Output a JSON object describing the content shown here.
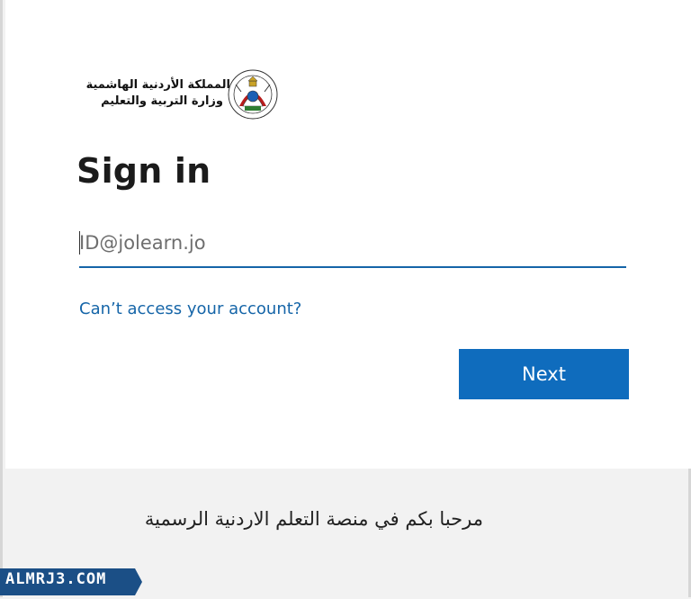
{
  "logo": {
    "line1": "المملكة الأردنية الهاشمية",
    "line2": "وزارة التربية والتعليم"
  },
  "signin": {
    "title": "Sign in",
    "email_placeholder": "ID@jolearn.jo",
    "email_value": "",
    "help_link": "Can’t access your account?",
    "next_label": "Next"
  },
  "footer": {
    "welcome": "مرحبا بكم في منصة التعلم الاردنية الرسمية"
  },
  "watermark": {
    "text": "ALMRJ3.COM"
  },
  "colors": {
    "accent": "#0f6cbd",
    "link": "#1565a8",
    "footer_bg": "#f2f2f2",
    "watermark_bg": "#1b4f86"
  }
}
